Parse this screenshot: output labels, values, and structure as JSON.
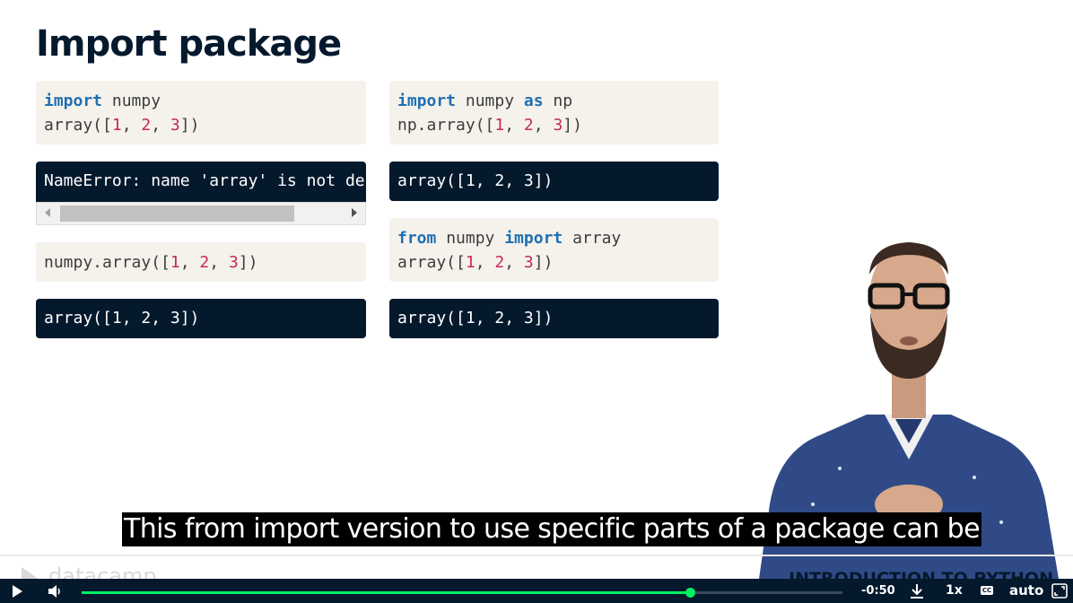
{
  "slide": {
    "title": "Import package",
    "course_title": "INTRODUCTION TO PYTHON",
    "logo_text": "datacamp"
  },
  "code_blocks": {
    "a1_l1_kw": "import",
    "a1_l1_rest": " numpy",
    "a1_l2_a": "array([",
    "a1_l2_n1": "1",
    "a1_l2_s1": ", ",
    "a1_l2_n2": "2",
    "a1_l2_s2": ", ",
    "a1_l2_n3": "3",
    "a1_l2_end": "])",
    "a1_output": "NameError: name 'array' is not defined",
    "a2_a": "numpy.array([",
    "a2_n1": "1",
    "a2_s1": ", ",
    "a2_n2": "2",
    "a2_s2": ", ",
    "a2_n3": "3",
    "a2_end": "])",
    "a2_output": "array([1, 2, 3])",
    "b1_l1_kw1": "import",
    "b1_l1_mid": " numpy ",
    "b1_l1_kw2": "as",
    "b1_l1_end": " np",
    "b1_l2_a": "np.array([",
    "b1_l2_n1": "1",
    "b1_l2_s1": ", ",
    "b1_l2_n2": "2",
    "b1_l2_s2": ", ",
    "b1_l2_n3": "3",
    "b1_l2_end": "])",
    "b1_output": "array([1, 2, 3])",
    "b2_l1_kw1": "from",
    "b2_l1_mid": " numpy ",
    "b2_l1_kw2": "import",
    "b2_l1_end": " array",
    "b2_l2_a": "array([",
    "b2_l2_n1": "1",
    "b2_l2_s1": ", ",
    "b2_l2_n2": "2",
    "b2_l2_s2": ", ",
    "b2_l2_n3": "3",
    "b2_l2_end": "])",
    "b2_output": "array([1, 2, 3])"
  },
  "caption": "This from import version to use specific parts of a package can be",
  "player": {
    "time_remaining": "-0:50",
    "speed": "1x",
    "cc_label": "CC",
    "quality": "auto",
    "progress": 0.8,
    "accent": "#03ef62",
    "bar_color": "#05192d",
    "icons": [
      "play-icon",
      "volume-icon",
      "download-icon",
      "cc-icon",
      "fullscreen-icon"
    ]
  }
}
